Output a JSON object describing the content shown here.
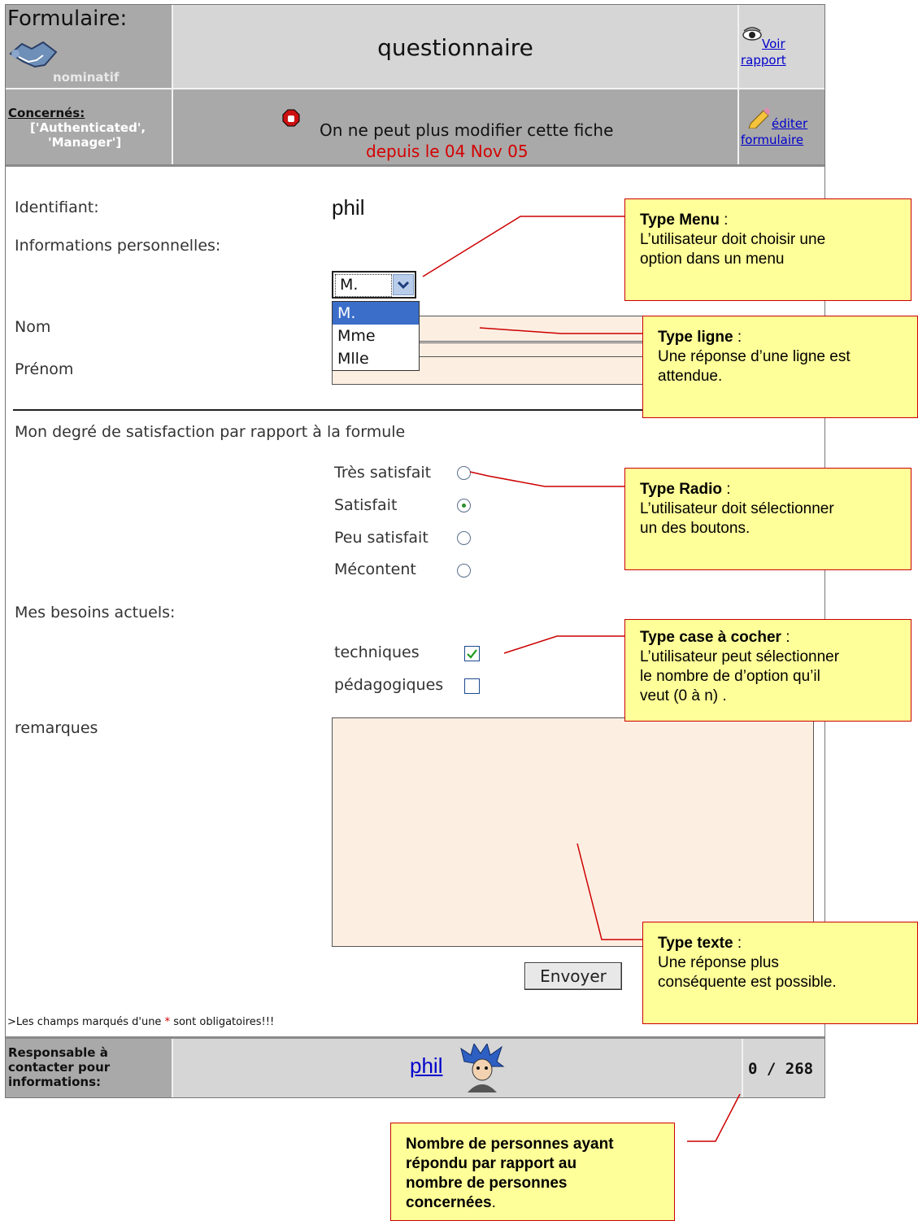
{
  "header": {
    "form_label": "Formulaire:",
    "form_type": "nominatif",
    "title": "questionnaire",
    "view_report_line1": "Voir",
    "view_report_line2": "rapport",
    "concerned_label": "Concernés:",
    "concerned_value_line1": "['Authenticated',",
    "concerned_value_line2": "'Manager']",
    "locked_message": "On ne peut plus modifier cette fiche",
    "locked_date": "depuis le 04 Nov 05",
    "edit_form_line1": "éditer",
    "edit_form_line2": "formulaire"
  },
  "form": {
    "identifier_label": "Identifiant:",
    "identifier_value": "phil",
    "personal_info_label": "Informations personnelles:",
    "civility_selected": "M.",
    "civility_options": [
      "M.",
      "Mme",
      "Mlle"
    ],
    "nom_label": "Nom",
    "prenom_label": "Prénom",
    "satisfaction_label": "Mon degré de satisfaction par rapport à la formule",
    "satisfaction_options": [
      "Très satisfait",
      "Satisfait",
      "Peu satisfait",
      "Mécontent"
    ],
    "satisfaction_selected": "Satisfait",
    "needs_label": "Mes besoins actuels:",
    "needs_options": [
      {
        "label": "techniques",
        "checked": true
      },
      {
        "label": "pédagogiques",
        "checked": false
      }
    ],
    "remarks_label": "remarques",
    "submit_label": "Envoyer",
    "required_note_prefix": ">Les champs marqués d'une ",
    "required_note_star": "*",
    "required_note_suffix": " sont obligatoires!!!"
  },
  "footer": {
    "contact_line1": "Responsable à",
    "contact_line2": "contacter pour",
    "contact_line3": "informations:",
    "contact_name": "phil",
    "count": "0 / 268"
  },
  "callouts": {
    "menu_title": "Type Menu",
    "menu_text1": "L’utilisateur doit choisir une",
    "menu_text2": "option dans un menu",
    "ligne_title": "Type ligne",
    "ligne_text1": "Une réponse d’une ligne est",
    "ligne_text2": "attendue.",
    "radio_title": "Type Radio",
    "radio_text1": "L’utilisateur doit sélectionner",
    "radio_text2": "un des boutons.",
    "case_title": "Type case à cocher",
    "case_text1": "L’utilisateur peut sélectionner",
    "case_text2": "le nombre de d’option qu’il",
    "case_text3": "veut (0 à n) .",
    "texte_title": "Type texte",
    "texte_text1": "Une réponse plus",
    "texte_text2": "conséquente est possible.",
    "count_line1": "Nombre de personnes ayant",
    "count_line2": "répondu par rapport au",
    "count_line3": "nombre de personnes",
    "count_line4": "concernées"
  },
  "colors": {
    "header_light": "#d6d6d6",
    "header_dark": "#a9a9a9",
    "input_bg": "#fdeee2",
    "callout_bg": "#ffff99",
    "callout_border": "#cc0000",
    "date_red": "#d40000",
    "link_blue": "#0000cc"
  }
}
